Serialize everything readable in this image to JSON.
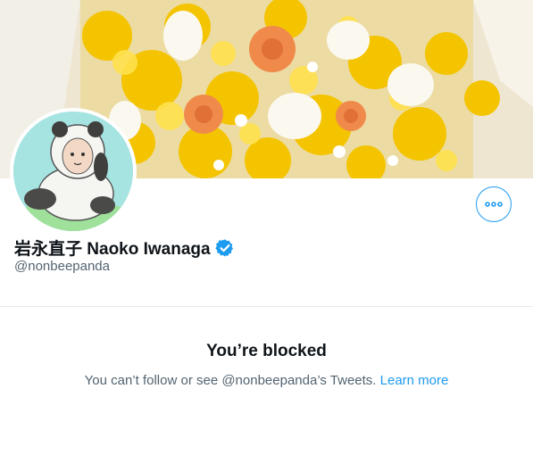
{
  "profile": {
    "display_name": "岩永直子 Naoko Iwanaga",
    "handle": "@nonbeepanda",
    "verified": true,
    "banner_image": "yellow-mimosa-and-orange-rose-bouquet",
    "avatar_image": "panda-costume-character-illustration"
  },
  "actions": {
    "more_icon": "more-horizontal-icon"
  },
  "blocked": {
    "title": "You’re blocked",
    "message": "You can’t follow or see @nonbeepanda’s Tweets.",
    "link_label": "Learn more"
  },
  "colors": {
    "accent": "#1d9bf0",
    "text_primary": "#0f1419",
    "text_secondary": "#536471",
    "divider": "#e7e9ea"
  }
}
